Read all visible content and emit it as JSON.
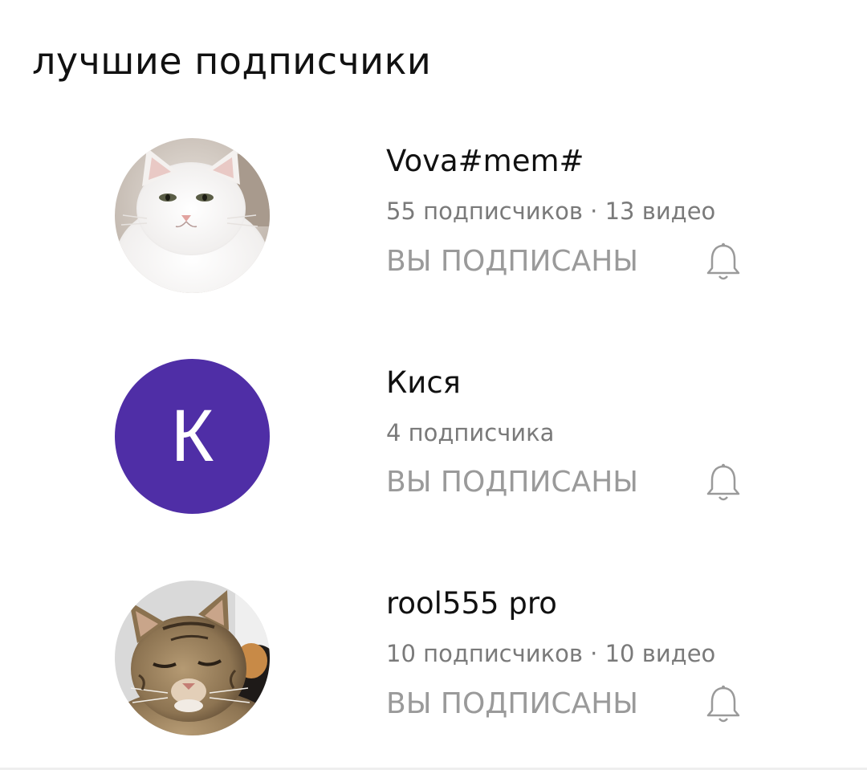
{
  "section": {
    "title": "лучшие подписчики"
  },
  "colors": {
    "text_primary": "#111111",
    "text_secondary": "#7a7a7a",
    "status_text": "#9a9a9a",
    "avatar_letter_bg": "#4f2ea6"
  },
  "subscribers": [
    {
      "name": "Vova#mem#",
      "meta": "55 подписчиков · 13 видео",
      "status": "ВЫ ПОДПИСАНЫ",
      "avatar": "white-cat-photo",
      "bell_icon": "bell-icon"
    },
    {
      "name": "Кися",
      "meta": "4 подписчика",
      "status": "ВЫ ПОДПИСАНЫ",
      "avatar_letter": "К",
      "bell_icon": "bell-icon"
    },
    {
      "name": "rool555 pro",
      "meta": "10 подписчиков · 10 видео",
      "status": "ВЫ ПОДПИСАНЫ",
      "avatar": "tabby-cat-photo",
      "bell_icon": "bell-icon"
    }
  ]
}
